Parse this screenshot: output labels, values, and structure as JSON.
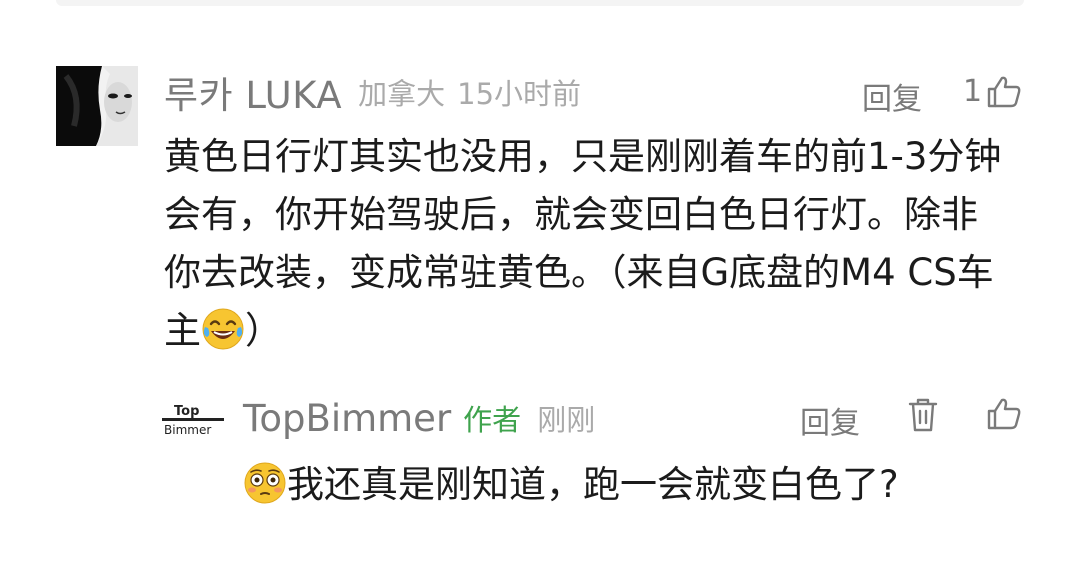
{
  "comment": {
    "username": "루카 LUKA",
    "location": "加拿大",
    "time": "15小时前",
    "reply_label": "回复",
    "like_count": "1",
    "text_before_emoji": "黄色日行灯其实也没用，只是刚刚着车的前1-3分钟会有，你开始驾驶后，就会变回白色日行灯。除非你去改装，变成常驻黄色。（来自G底盘的M4 CS车主",
    "text_after_emoji": "）",
    "emoji_icon": "laughing-tears-emoji"
  },
  "reply": {
    "avatar_text_top": "Top",
    "avatar_text_bottom": "Bimmer",
    "username": "TopBimmer",
    "author_badge": "作者",
    "time": "刚刚",
    "reply_label": "回复",
    "emoji_icon": "flushed-face-emoji",
    "text": "我还真是刚知道，跑一会就变白色了?"
  },
  "colors": {
    "meta_gray": "#7a7a7a",
    "light_gray": "#aaaaaa",
    "author_green": "#3fa34d",
    "text_dark": "#1b1b1b"
  }
}
